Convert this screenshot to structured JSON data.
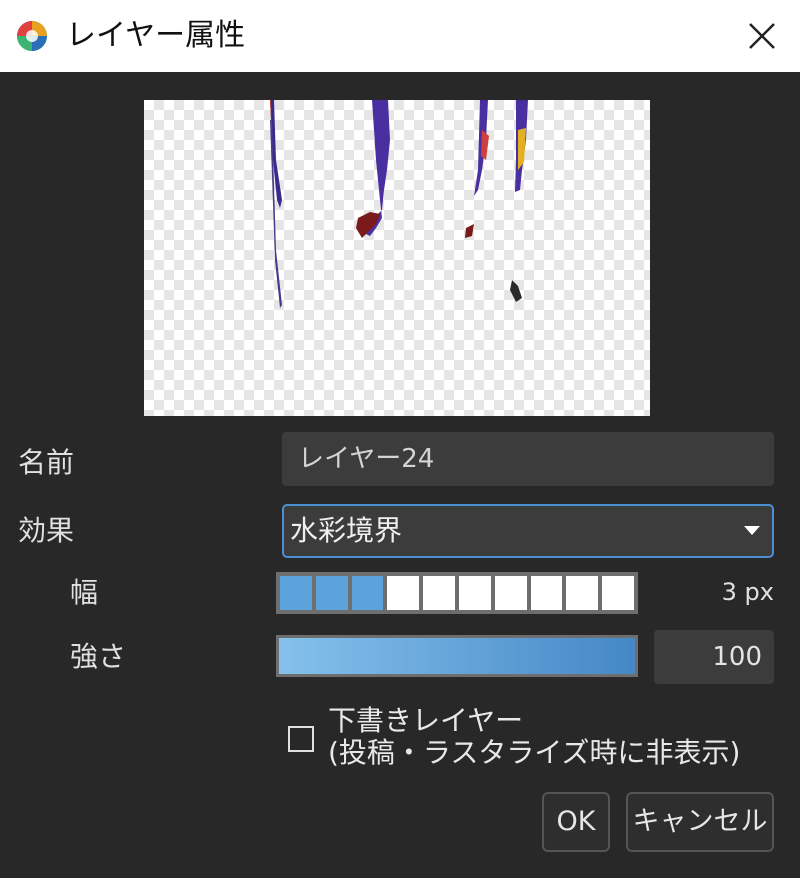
{
  "window": {
    "title": "レイヤー属性",
    "close_icon": "close-icon",
    "app_icon": "colorful-circle-app-icon"
  },
  "preview": {
    "label_visible": false,
    "background": "transparency-checkerboard"
  },
  "fields": {
    "name_label": "名前",
    "name_value": "レイヤー24",
    "effect_label": "効果",
    "effect_value": "水彩境界",
    "width_label": "幅",
    "width_value": "3 px",
    "width_segments_total": 10,
    "width_segments_filled": 3,
    "strength_label": "強さ",
    "strength_value": "100",
    "strength_fraction": 1.0
  },
  "checkbox": {
    "label_line1": "下書きレイヤー",
    "label_line2": "(投稿・ラスタライズ時に非表示)",
    "checked": false
  },
  "buttons": {
    "ok": "OK",
    "cancel": "キャンセル"
  },
  "colors": {
    "accent": "#4b8fd1",
    "segment_on": "#5aa3dc",
    "dialog_bg": "#282828"
  }
}
